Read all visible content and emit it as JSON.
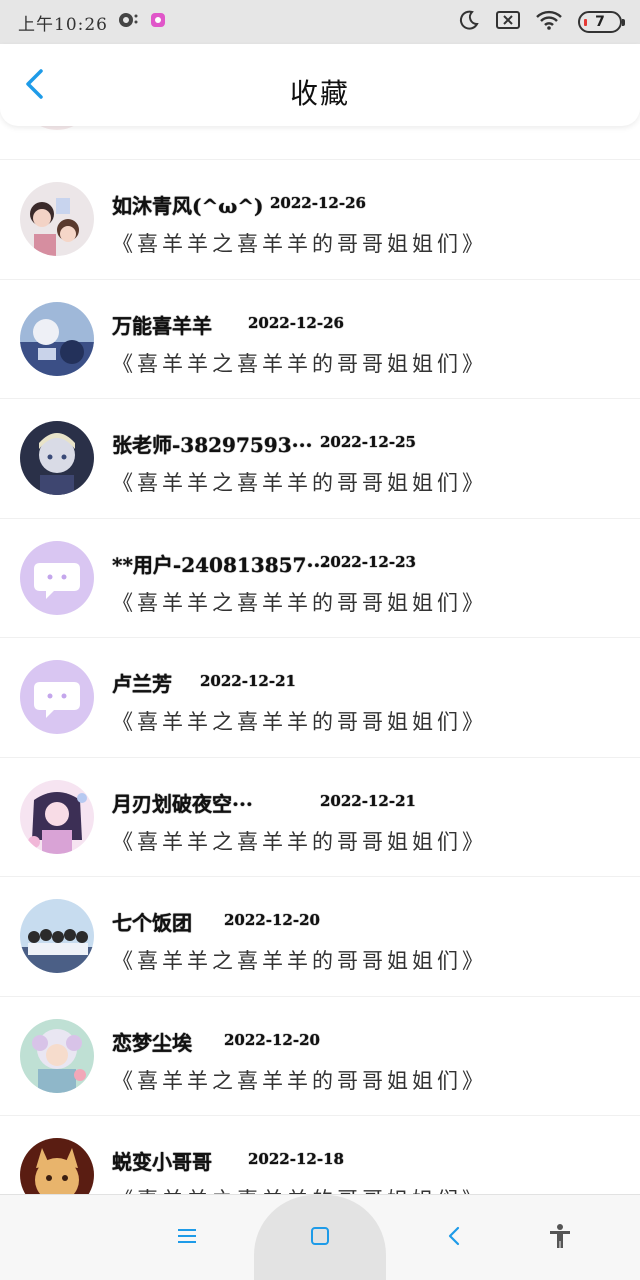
{
  "status_bar": {
    "time": "上午10:26",
    "battery_level": "7",
    "icons": [
      "app-notification-icon",
      "app-badge-icon",
      "moon-icon",
      "sim-icon",
      "wifi-icon",
      "battery-icon"
    ]
  },
  "header": {
    "title": "收藏",
    "back_icon": "chevron-left-icon",
    "accent_color": "#1e9be8"
  },
  "list": {
    "subtitle": "《喜羊羊之喜羊羊的哥哥姐姐们》",
    "items": [
      {
        "name": "如沐青风(^ω^)",
        "date": "2022-12-26",
        "avatar": "photo"
      },
      {
        "name": "万能喜羊羊",
        "date": "2022-12-26",
        "avatar": "photo"
      },
      {
        "name": "张老师-38297593···",
        "date": "2022-12-25",
        "avatar": "photo"
      },
      {
        "name": "**用户-240813857···",
        "date": "2022-12-23",
        "avatar": "default-chat-bubble"
      },
      {
        "name": "卢兰芳",
        "date": "2022-12-21",
        "avatar": "default-chat-bubble"
      },
      {
        "name": "月刃划破夜空···",
        "date": "2022-12-21",
        "avatar": "photo"
      },
      {
        "name": "七个饭团",
        "date": "2022-12-20",
        "avatar": "photo"
      },
      {
        "name": "恋梦尘埃",
        "date": "2022-12-20",
        "avatar": "photo"
      },
      {
        "name": "蜕变小哥哥",
        "date": "2022-12-18",
        "avatar": "photo"
      }
    ]
  },
  "nav_bar": {
    "icons": [
      "menu-icon",
      "home-square-icon",
      "back-arrow-icon",
      "accessibility-icon"
    ],
    "accent_color": "#1e9be8"
  }
}
